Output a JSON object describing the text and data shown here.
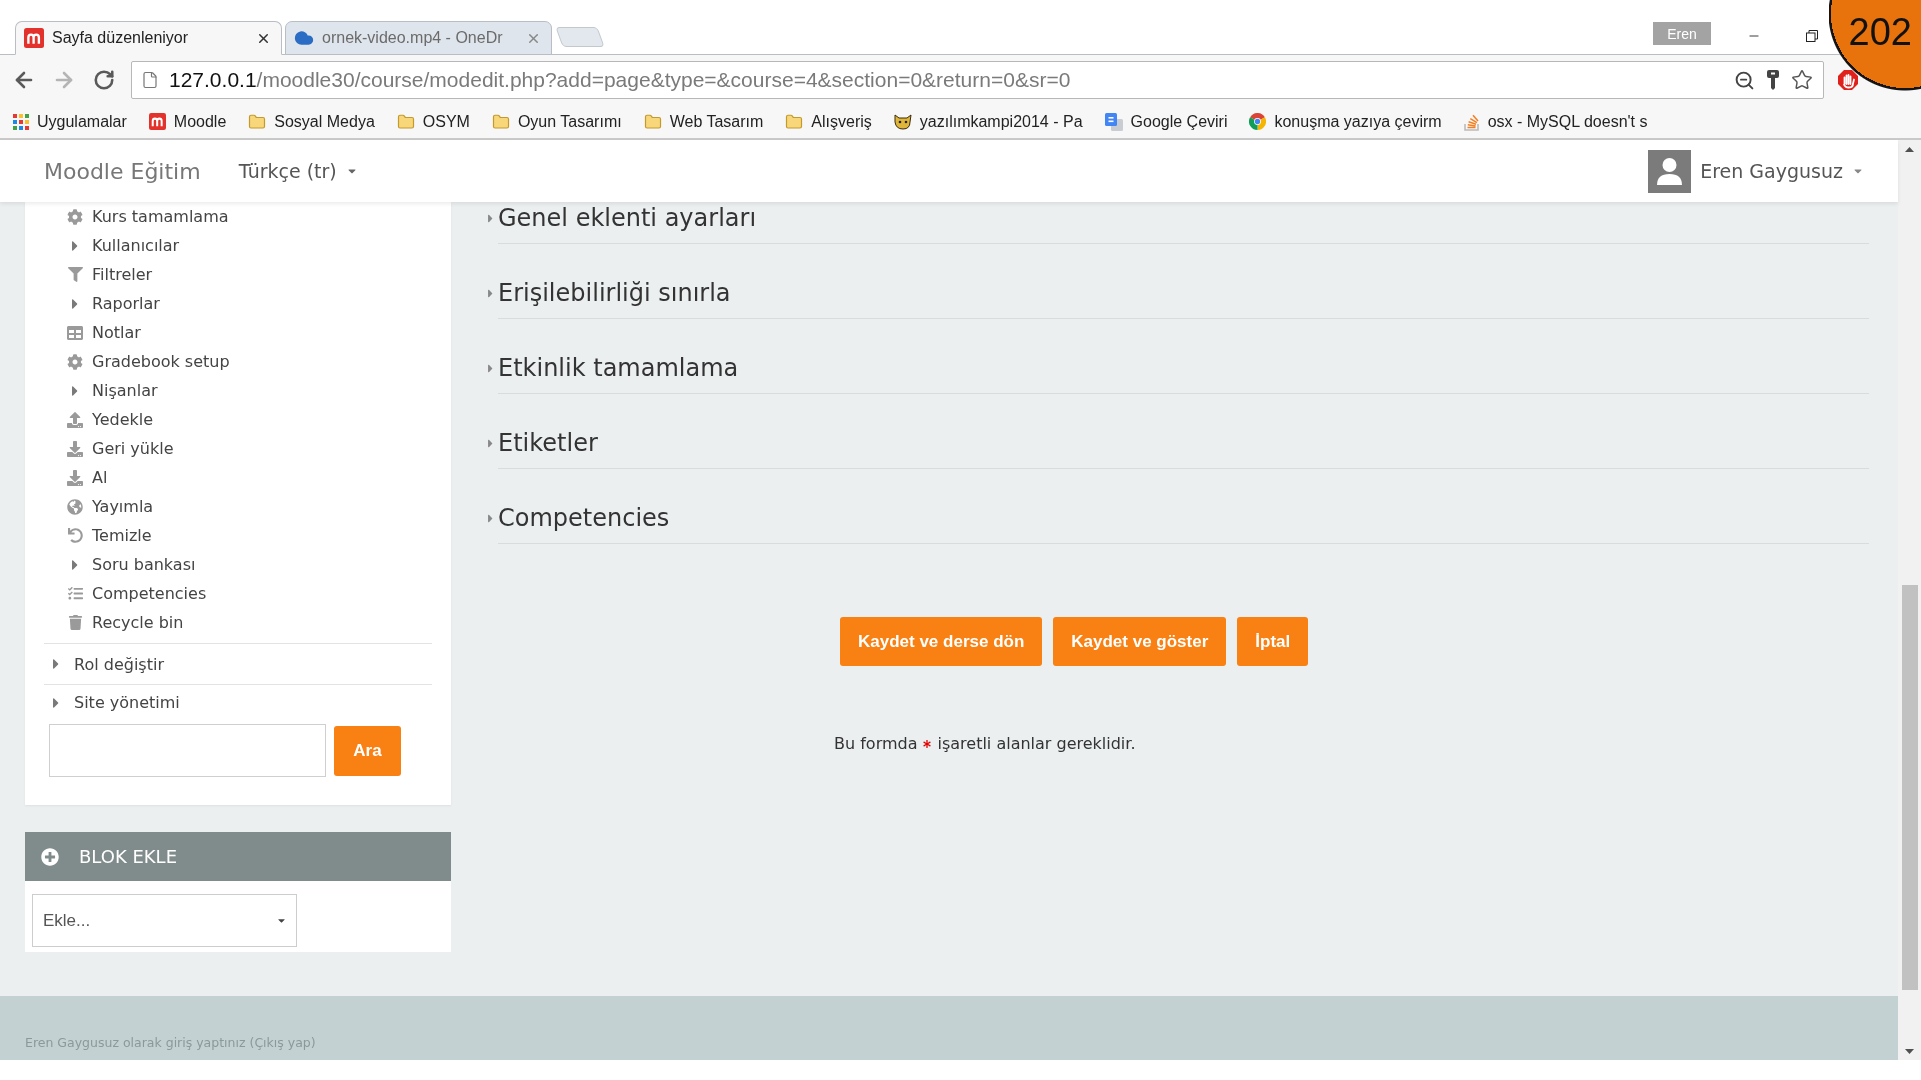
{
  "browser": {
    "tabs": [
      {
        "title": "Sayfa düzenleniyor",
        "kind": "moodle",
        "selected": true
      },
      {
        "title": "ornek-video.mp4 - OneDr",
        "kind": "cloud",
        "selected": false
      }
    ],
    "profile": "Eren",
    "counter": "202",
    "forward_disabled": true,
    "address": {
      "host": "127.0.0.1",
      "path": "/moodle30/course/modedit.php?add=page&type=&course=4&section=0&return=0&sr=0"
    },
    "bookmarks": [
      {
        "label": "Uygulamalar",
        "kind": "apps"
      },
      {
        "label": "Moodle",
        "kind": "moodle"
      },
      {
        "label": "Sosyal Medya",
        "kind": "folder"
      },
      {
        "label": "OSYM",
        "kind": "folder"
      },
      {
        "label": "Oyun Tasarımı",
        "kind": "folder"
      },
      {
        "label": "Web Tasarım",
        "kind": "folder"
      },
      {
        "label": "Alışveriş",
        "kind": "folder"
      },
      {
        "label": "yazılımkampi2014 - Pa",
        "kind": "cat"
      },
      {
        "label": "Google Çeviri",
        "kind": "translate"
      },
      {
        "label": "konuşma yazıya çevirm",
        "kind": "chrome"
      },
      {
        "label": "osx - MySQL doesn't s",
        "kind": "stack"
      }
    ]
  },
  "navbar": {
    "brand": "Moodle Eğitim",
    "language": "Türkçe (tr)",
    "user": "Eren Gaygusuz"
  },
  "sidebar": {
    "items": [
      {
        "label": "Kurs tamamlama",
        "kind": "gear"
      },
      {
        "label": "Kullanıcılar",
        "kind": "branch"
      },
      {
        "label": "Filtreler",
        "kind": "filter"
      },
      {
        "label": "Raporlar",
        "kind": "branch"
      },
      {
        "label": "Notlar",
        "kind": "table"
      },
      {
        "label": "Gradebook setup",
        "kind": "gear"
      },
      {
        "label": "Nişanlar",
        "kind": "branch"
      },
      {
        "label": "Yedekle",
        "kind": "backup"
      },
      {
        "label": "Geri yükle",
        "kind": "restore"
      },
      {
        "label": "Al",
        "kind": "import"
      },
      {
        "label": "Yayımla",
        "kind": "publish"
      },
      {
        "label": "Temizle",
        "kind": "reset"
      },
      {
        "label": "Soru bankası",
        "kind": "branch"
      },
      {
        "label": "Competencies",
        "kind": "competencies"
      },
      {
        "label": "Recycle bin",
        "kind": "trash"
      }
    ],
    "sections": [
      "Rol değiştir",
      "Site yönetimi"
    ],
    "search_button": "Ara"
  },
  "add_block": {
    "title": "BLOK EKLE",
    "select": "Ekle..."
  },
  "form": {
    "sections": [
      "Genel eklenti ayarları",
      "Erişilebilirliği sınırla",
      "Etkinlik tamamlama",
      "Etiketler",
      "Competencies"
    ],
    "buttons": [
      "Kaydet ve derse dön",
      "Kaydet ve göster",
      "İptal"
    ],
    "required_note": {
      "before": "Bu formda",
      "after": "işaretli alanlar gereklidir."
    }
  },
  "footer": {
    "login_info": "Eren Gaygusuz olarak giriş yaptınız (Çıkış yap)"
  }
}
